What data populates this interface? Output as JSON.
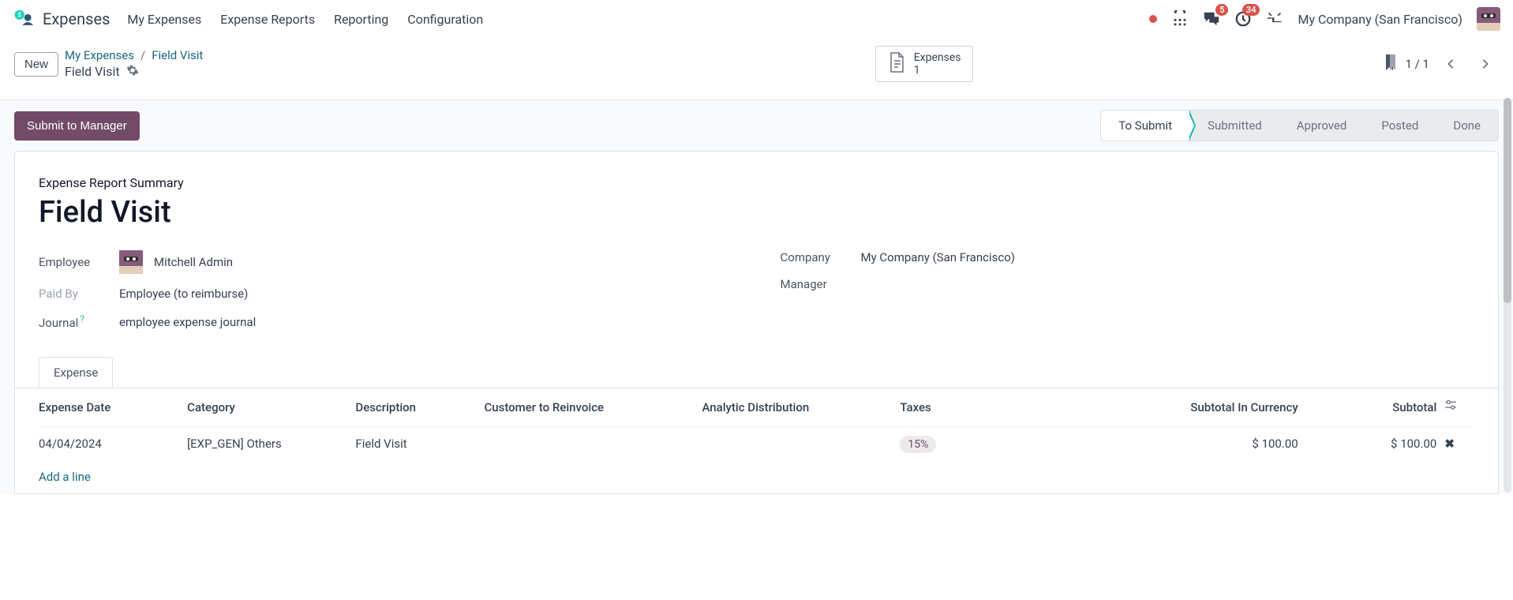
{
  "app": {
    "title": "Expenses"
  },
  "nav": {
    "items": [
      "My Expenses",
      "Expense Reports",
      "Reporting",
      "Configuration"
    ]
  },
  "systray": {
    "discuss_badge": "5",
    "activity_badge": "34",
    "company": "My Company (San Francisco)"
  },
  "control": {
    "new": "New",
    "breadcrumb_parent": "My Expenses",
    "breadcrumb_sep": "/",
    "breadcrumb_leaf": "Field Visit",
    "record_name": "Field Visit",
    "stat_label": "Expenses",
    "stat_count": "1",
    "pager": "1 / 1"
  },
  "actions": {
    "submit": "Submit to Manager"
  },
  "status": {
    "items": [
      "To Submit",
      "Submitted",
      "Approved",
      "Posted",
      "Done"
    ],
    "active_index": 0
  },
  "form": {
    "summary_label": "Expense Report Summary",
    "title": "Field Visit",
    "labels": {
      "employee": "Employee",
      "paid_by": "Paid By",
      "journal": "Journal",
      "company": "Company",
      "manager": "Manager"
    },
    "values": {
      "employee": "Mitchell Admin",
      "paid_by": "Employee (to reimburse)",
      "journal": "employee expense journal",
      "company": "My Company (San Francisco)",
      "manager": ""
    },
    "help_q": "?"
  },
  "tab": {
    "expense": "Expense"
  },
  "table": {
    "headers": {
      "date": "Expense Date",
      "category": "Category",
      "description": "Description",
      "customer": "Customer to Reinvoice",
      "analytic": "Analytic Distribution",
      "taxes": "Taxes",
      "subtotal_currency": "Subtotal In Currency",
      "subtotal": "Subtotal"
    },
    "rows": [
      {
        "date": "04/04/2024",
        "category": "[EXP_GEN] Others",
        "description": "Field Visit",
        "customer": "",
        "analytic": "",
        "taxes": "15%",
        "subtotal_currency": "$ 100.00",
        "subtotal": "$ 100.00"
      }
    ],
    "add_line": "Add a line"
  }
}
